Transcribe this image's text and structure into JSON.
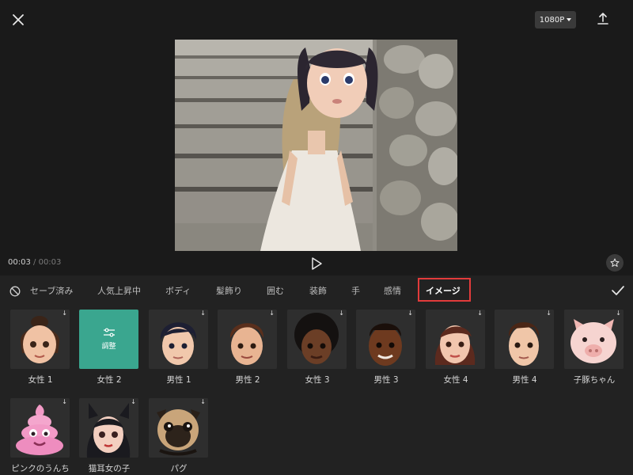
{
  "header": {
    "resolution": "1080P"
  },
  "player": {
    "current_time": "00:03",
    "separator": "/",
    "total_time": "00:03"
  },
  "tabs": [
    {
      "label": "セーブ済み"
    },
    {
      "label": "人気上昇中"
    },
    {
      "label": "ボディ"
    },
    {
      "label": "髪飾り"
    },
    {
      "label": "囲む"
    },
    {
      "label": "装飾"
    },
    {
      "label": "手"
    },
    {
      "label": "感情"
    },
    {
      "label": "イメージ",
      "active": true
    }
  ],
  "avatars": [
    {
      "label": "女性 1"
    },
    {
      "label": "女性 2",
      "selected": true,
      "overlay_text": "調整"
    },
    {
      "label": "男性 1"
    },
    {
      "label": "男性 2"
    },
    {
      "label": "女性 3"
    },
    {
      "label": "男性 3"
    },
    {
      "label": "女性 4"
    },
    {
      "label": "男性 4"
    },
    {
      "label": "子豚ちゃん"
    },
    {
      "label": "ピンクのうんち"
    },
    {
      "label": "猫耳女の子"
    },
    {
      "label": "パグ"
    }
  ],
  "colors": {
    "accent_red": "#e23b3b",
    "selected_tile": "#3aa68f"
  },
  "icons": {
    "close": "close-icon",
    "export": "export-icon",
    "play": "play-icon",
    "favorite": "star-icon",
    "none": "no-effect-icon",
    "confirm": "check-icon",
    "download": "download-arrow-icon"
  }
}
